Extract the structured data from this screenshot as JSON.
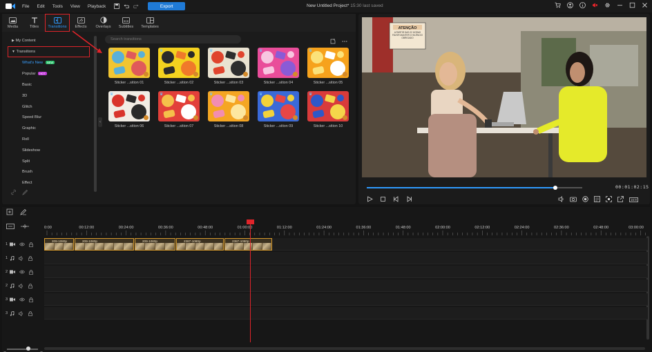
{
  "menu": {
    "file": "File",
    "edit": "Edit",
    "tools": "Tools",
    "view": "View",
    "playback": "Playback",
    "export": "Export"
  },
  "document": {
    "title": "New Untitled Project*",
    "saved": "15:30 last saved"
  },
  "room_tabs": [
    {
      "label": "Media",
      "icon": "media-icon"
    },
    {
      "label": "Titles",
      "icon": "titles-icon"
    },
    {
      "label": "Transitions",
      "icon": "transitions-icon"
    },
    {
      "label": "Effects",
      "icon": "effects-icon"
    },
    {
      "label": "Overlays",
      "icon": "overlays-icon"
    },
    {
      "label": "Subtitles",
      "icon": "subtitles-icon"
    },
    {
      "label": "Templates",
      "icon": "templates-icon"
    }
  ],
  "sidebar": {
    "my_content": "My Content",
    "transitions": "Transitions",
    "whats_new": "What's New",
    "new_badge": "NEW",
    "popular": "Popular",
    "hot_badge": "HOT",
    "items": [
      "Basic",
      "3D",
      "Glitch",
      "Speed Blur",
      "Graphic",
      "Roll",
      "Slideshow",
      "Split",
      "Brush",
      "Effect"
    ]
  },
  "search": {
    "placeholder": "Search transitions"
  },
  "tiles": [
    {
      "label": "Sticker ...sition 01",
      "colors": [
        "#f2c531",
        "#5ab0d8",
        "#e05a5a"
      ]
    },
    {
      "label": "Sticker ...sition 02",
      "colors": [
        "#f4d21f",
        "#2a2a2a",
        "#f07a2a"
      ]
    },
    {
      "label": "Sticker ...sition 03",
      "colors": [
        "#e9e2d0",
        "#e0442e",
        "#2e2e2e"
      ]
    },
    {
      "label": "Sticker ...sition 04",
      "colors": [
        "#e94d9a",
        "#f7c6e0",
        "#8a5bd6"
      ]
    },
    {
      "label": "Sticker ...sition 05",
      "colors": [
        "#f6a21c",
        "#fbe27a",
        "#ffffff"
      ]
    },
    {
      "label": "Sticker ...sition 06",
      "colors": [
        "#f1ece4",
        "#d9342b",
        "#2a2a2a"
      ]
    },
    {
      "label": "Sticker ...sition 07",
      "colors": [
        "#e2403a",
        "#f5c04a",
        "#ffffff"
      ]
    },
    {
      "label": "Sticker ...sition 08",
      "colors": [
        "#f5a623",
        "#f28db2",
        "#fde7a0"
      ]
    },
    {
      "label": "Sticker ...sition 09",
      "colors": [
        "#3a6ad8",
        "#f2d23a",
        "#e64646"
      ]
    },
    {
      "label": "Sticker ...sition 10",
      "colors": [
        "#d93b3b",
        "#2f58c8",
        "#f5d54a"
      ]
    }
  ],
  "player": {
    "timecode": "00:01:02:15",
    "progress": 0.875,
    "resolution": "16:9"
  },
  "ruler": [
    "0:00",
    "00:12:00",
    "00:24:00",
    "00:36:00",
    "00:48:00",
    "01:00:00",
    "01:12:00",
    "01:24:00",
    "01:36:00",
    "01:48:00",
    "02:00:00",
    "02:12:00",
    "02:24:00",
    "02:36:00",
    "02:48:00",
    "03:00:00"
  ],
  "tracks": [
    {
      "num": "1",
      "type": "video"
    },
    {
      "num": "1",
      "type": "audio"
    },
    {
      "num": "2",
      "type": "video"
    },
    {
      "num": "2",
      "type": "audio"
    },
    {
      "num": "3",
      "type": "video"
    },
    {
      "num": "3",
      "type": "audio"
    }
  ],
  "clips": [
    {
      "label": "209-1080p"
    },
    {
      "label": "209-1080p"
    },
    {
      "label": "209-1080p"
    },
    {
      "label": "2387-1080p"
    },
    {
      "label": "2387-1080p"
    }
  ],
  "video_scene": {
    "sign_title": "ATENÇÃO",
    "sign_text": "A PARTIR DAS 22 HORAS FAVOR MANTER O SILÊNCIO OBRIGADO"
  }
}
